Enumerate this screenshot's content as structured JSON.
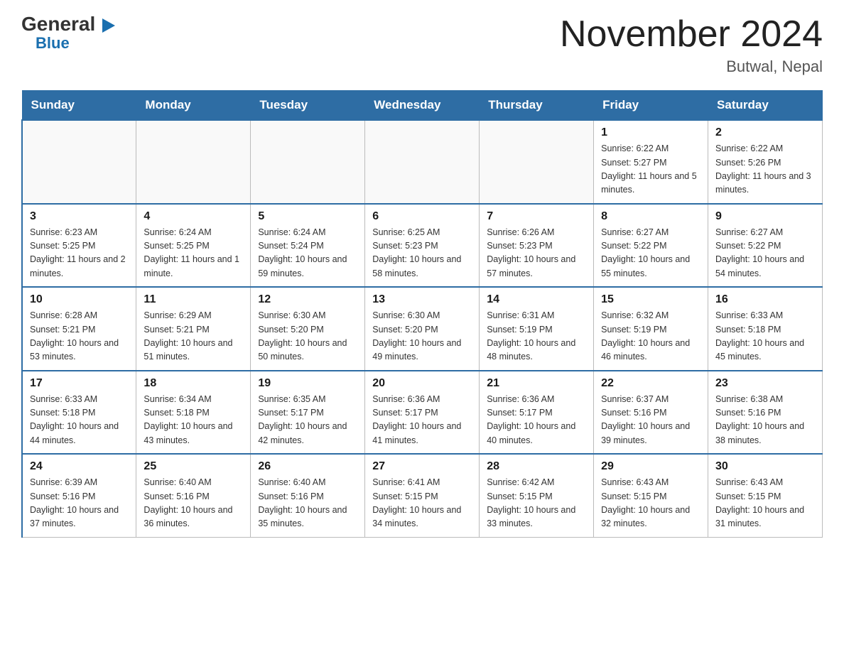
{
  "logo": {
    "general": "General",
    "triangle": "▶",
    "blue": "Blue"
  },
  "title": "November 2024",
  "location": "Butwal, Nepal",
  "days_of_week": [
    "Sunday",
    "Monday",
    "Tuesday",
    "Wednesday",
    "Thursday",
    "Friday",
    "Saturday"
  ],
  "weeks": [
    [
      {
        "day": "",
        "info": ""
      },
      {
        "day": "",
        "info": ""
      },
      {
        "day": "",
        "info": ""
      },
      {
        "day": "",
        "info": ""
      },
      {
        "day": "",
        "info": ""
      },
      {
        "day": "1",
        "info": "Sunrise: 6:22 AM\nSunset: 5:27 PM\nDaylight: 11 hours and 5 minutes."
      },
      {
        "day": "2",
        "info": "Sunrise: 6:22 AM\nSunset: 5:26 PM\nDaylight: 11 hours and 3 minutes."
      }
    ],
    [
      {
        "day": "3",
        "info": "Sunrise: 6:23 AM\nSunset: 5:25 PM\nDaylight: 11 hours and 2 minutes."
      },
      {
        "day": "4",
        "info": "Sunrise: 6:24 AM\nSunset: 5:25 PM\nDaylight: 11 hours and 1 minute."
      },
      {
        "day": "5",
        "info": "Sunrise: 6:24 AM\nSunset: 5:24 PM\nDaylight: 10 hours and 59 minutes."
      },
      {
        "day": "6",
        "info": "Sunrise: 6:25 AM\nSunset: 5:23 PM\nDaylight: 10 hours and 58 minutes."
      },
      {
        "day": "7",
        "info": "Sunrise: 6:26 AM\nSunset: 5:23 PM\nDaylight: 10 hours and 57 minutes."
      },
      {
        "day": "8",
        "info": "Sunrise: 6:27 AM\nSunset: 5:22 PM\nDaylight: 10 hours and 55 minutes."
      },
      {
        "day": "9",
        "info": "Sunrise: 6:27 AM\nSunset: 5:22 PM\nDaylight: 10 hours and 54 minutes."
      }
    ],
    [
      {
        "day": "10",
        "info": "Sunrise: 6:28 AM\nSunset: 5:21 PM\nDaylight: 10 hours and 53 minutes."
      },
      {
        "day": "11",
        "info": "Sunrise: 6:29 AM\nSunset: 5:21 PM\nDaylight: 10 hours and 51 minutes."
      },
      {
        "day": "12",
        "info": "Sunrise: 6:30 AM\nSunset: 5:20 PM\nDaylight: 10 hours and 50 minutes."
      },
      {
        "day": "13",
        "info": "Sunrise: 6:30 AM\nSunset: 5:20 PM\nDaylight: 10 hours and 49 minutes."
      },
      {
        "day": "14",
        "info": "Sunrise: 6:31 AM\nSunset: 5:19 PM\nDaylight: 10 hours and 48 minutes."
      },
      {
        "day": "15",
        "info": "Sunrise: 6:32 AM\nSunset: 5:19 PM\nDaylight: 10 hours and 46 minutes."
      },
      {
        "day": "16",
        "info": "Sunrise: 6:33 AM\nSunset: 5:18 PM\nDaylight: 10 hours and 45 minutes."
      }
    ],
    [
      {
        "day": "17",
        "info": "Sunrise: 6:33 AM\nSunset: 5:18 PM\nDaylight: 10 hours and 44 minutes."
      },
      {
        "day": "18",
        "info": "Sunrise: 6:34 AM\nSunset: 5:18 PM\nDaylight: 10 hours and 43 minutes."
      },
      {
        "day": "19",
        "info": "Sunrise: 6:35 AM\nSunset: 5:17 PM\nDaylight: 10 hours and 42 minutes."
      },
      {
        "day": "20",
        "info": "Sunrise: 6:36 AM\nSunset: 5:17 PM\nDaylight: 10 hours and 41 minutes."
      },
      {
        "day": "21",
        "info": "Sunrise: 6:36 AM\nSunset: 5:17 PM\nDaylight: 10 hours and 40 minutes."
      },
      {
        "day": "22",
        "info": "Sunrise: 6:37 AM\nSunset: 5:16 PM\nDaylight: 10 hours and 39 minutes."
      },
      {
        "day": "23",
        "info": "Sunrise: 6:38 AM\nSunset: 5:16 PM\nDaylight: 10 hours and 38 minutes."
      }
    ],
    [
      {
        "day": "24",
        "info": "Sunrise: 6:39 AM\nSunset: 5:16 PM\nDaylight: 10 hours and 37 minutes."
      },
      {
        "day": "25",
        "info": "Sunrise: 6:40 AM\nSunset: 5:16 PM\nDaylight: 10 hours and 36 minutes."
      },
      {
        "day": "26",
        "info": "Sunrise: 6:40 AM\nSunset: 5:16 PM\nDaylight: 10 hours and 35 minutes."
      },
      {
        "day": "27",
        "info": "Sunrise: 6:41 AM\nSunset: 5:15 PM\nDaylight: 10 hours and 34 minutes."
      },
      {
        "day": "28",
        "info": "Sunrise: 6:42 AM\nSunset: 5:15 PM\nDaylight: 10 hours and 33 minutes."
      },
      {
        "day": "29",
        "info": "Sunrise: 6:43 AM\nSunset: 5:15 PM\nDaylight: 10 hours and 32 minutes."
      },
      {
        "day": "30",
        "info": "Sunrise: 6:43 AM\nSunset: 5:15 PM\nDaylight: 10 hours and 31 minutes."
      }
    ]
  ]
}
